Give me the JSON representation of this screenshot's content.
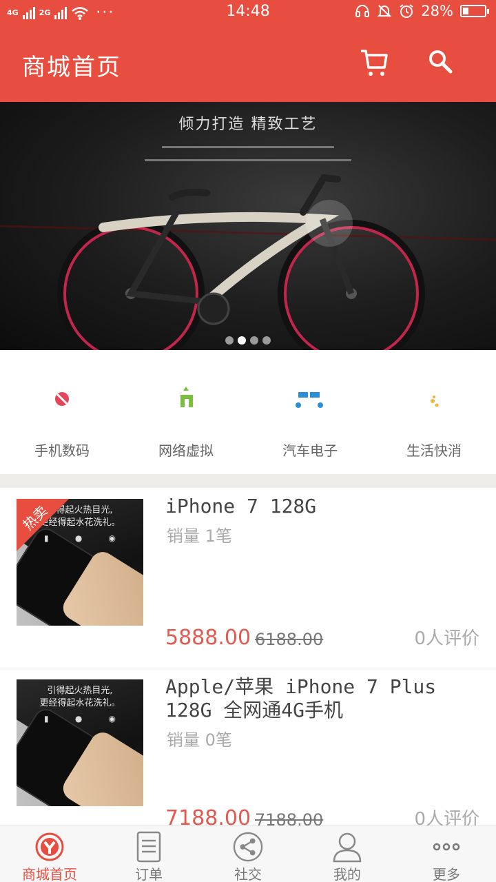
{
  "status_bar": {
    "network_1": "4G",
    "network_2": "2G",
    "more": "···",
    "time": "14:48",
    "battery": "28%",
    "battery_level": 0.28
  },
  "header": {
    "title": "商城首页",
    "cart_icon": "cart-icon",
    "search_icon": "search-icon"
  },
  "banner": {
    "heading": "倾力打造 精致工艺",
    "carousel": {
      "count": 4,
      "active_index": 1
    }
  },
  "categories": [
    {
      "label": "手机数码",
      "icon": "camera-icon",
      "color": "#e4475a"
    },
    {
      "label": "网络虚拟",
      "icon": "sim-card-icon",
      "color": "#7cbf3f"
    },
    {
      "label": "汽车电子",
      "icon": "car-icon",
      "color": "#2a8fd6"
    },
    {
      "label": "生活快消",
      "icon": "bottle-icon",
      "color": "#f0b43a"
    }
  ],
  "products": [
    {
      "title": "iPhone 7 128G",
      "sales": "销量 1笔",
      "price": "5888.00",
      "original_price": "6188.00",
      "reviews": "0人评价",
      "badge": "热卖",
      "thumb_text_1": "引得起火热目光,",
      "thumb_text_2": "更经得起水花洗礼。"
    },
    {
      "title": "Apple/苹果 iPhone 7 Plus 128G 全网通4G手机",
      "sales": "销量 0笔",
      "price": "7188.00",
      "original_price": "7188.00",
      "reviews": "0人评价",
      "thumb_text_1": "引得起火热目光,",
      "thumb_text_2": "更经得起水花洗礼。"
    }
  ],
  "tabbar": [
    {
      "label": "商城首页",
      "icon": "home-logo-icon",
      "active": true
    },
    {
      "label": "订单",
      "icon": "order-list-icon",
      "active": false
    },
    {
      "label": "社交",
      "icon": "share-icon",
      "active": false
    },
    {
      "label": "我的",
      "icon": "user-icon",
      "active": false
    },
    {
      "label": "更多",
      "icon": "more-icon",
      "active": false
    }
  ],
  "colors": {
    "brand": "#e84e40",
    "price": "#e25a4f"
  }
}
